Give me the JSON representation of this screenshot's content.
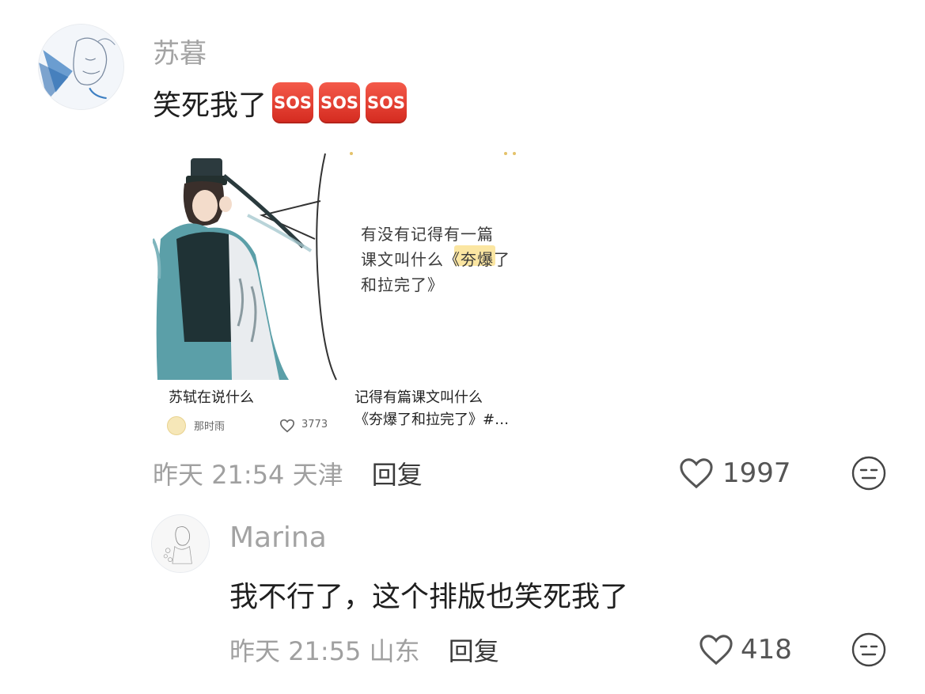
{
  "comment": {
    "username": "苏暮",
    "text": "笑死我了",
    "sos_emojis": [
      "SOS",
      "SOS",
      "SOS"
    ],
    "date": "昨天",
    "time": "21:54",
    "location": "天津",
    "reply_label": "回复",
    "likes": "1997",
    "icons": {
      "avatar": "anime-character-sketch-avatar",
      "like": "heart-outline-icon",
      "reaction": "neutral-face-icon"
    }
  },
  "cards": [
    {
      "title": "苏轼在说什么",
      "author": "那时雨",
      "likes": "3773",
      "image": "ancient-scholar-illustration-image"
    },
    {
      "handwritten_lines": [
        "有没有记得有一篇",
        "课文叫什么《夯爆了",
        "和拉完了》"
      ],
      "highlight": "夯爆",
      "title_line1": "记得有篇课文叫什么",
      "title_line2": "《夯爆了和拉完了》#…"
    }
  ],
  "reply": {
    "username": "Marina",
    "text": "我不行了，这个排版也笑死我了",
    "date": "昨天",
    "time": "21:55",
    "location": "山东",
    "reply_label": "回复",
    "likes": "418"
  },
  "colors": {
    "sos_red": "#e0352a",
    "highlight_yellow": "#fbe6a2",
    "robe_teal": "#5b9fa8"
  }
}
